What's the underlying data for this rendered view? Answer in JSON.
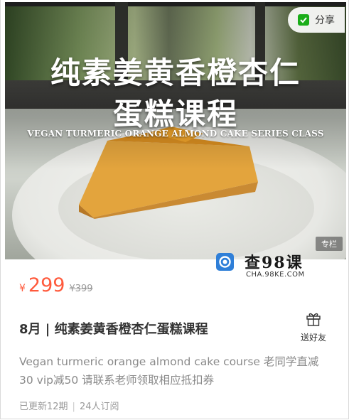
{
  "hero": {
    "title_line1": "纯素姜黄香橙杏仁",
    "title_line2": "蛋糕课程",
    "subtitle_en": "VEGAN TURMERIC ORANGE ALMOND CAKE SERIES CLASS",
    "share_label": "分享",
    "tag_label": "专栏"
  },
  "watermark": {
    "name": "查98课",
    "domain": "CHA.98KE.COM"
  },
  "price": {
    "currency": "¥",
    "value": "299",
    "original": "¥399"
  },
  "course": {
    "title": "8月 | 纯素姜黄香橙杏仁蛋糕课程",
    "gift_label": "送好友",
    "description": "Vegan turmeric orange almond cake course 老同学直减30 vip减50 请联系老师领取相应抵扣券",
    "updated": "已更新12期",
    "separator": "|",
    "subscribers": "24人订阅"
  },
  "colors": {
    "price": "#ff5a3c",
    "share_icon": "#1aad19"
  }
}
